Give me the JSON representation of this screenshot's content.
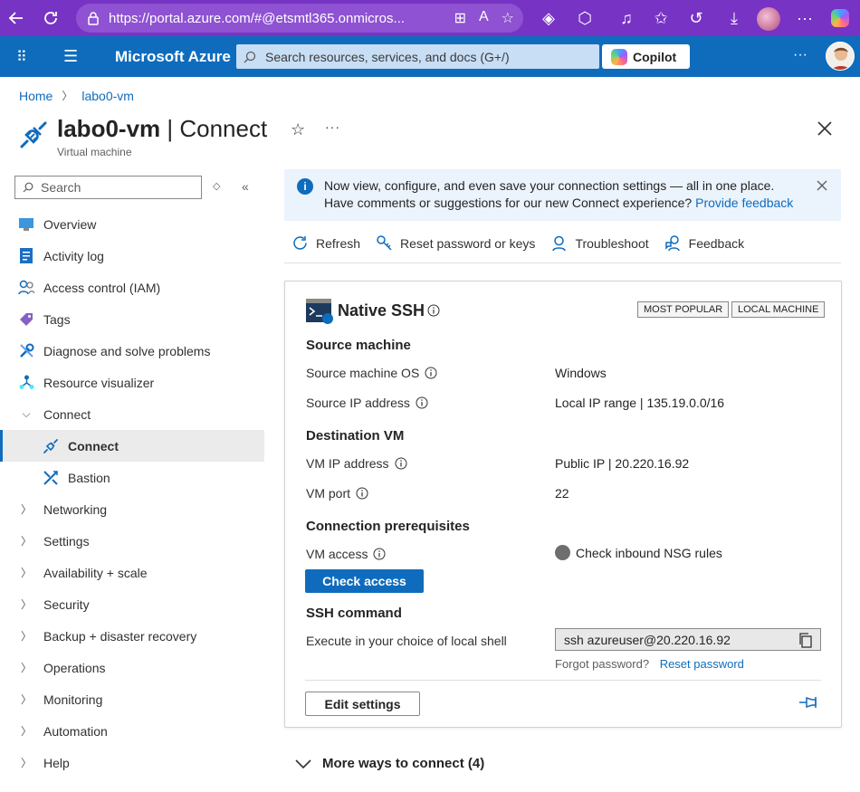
{
  "browser": {
    "url": "https://portal.azure.com/#@etsmtl365.onmicros..."
  },
  "header": {
    "brand": "Microsoft Azure",
    "search_placeholder": "Search resources, services, and docs (G+/)",
    "copilot_label": "Copilot",
    "more": "···"
  },
  "breadcrumb": {
    "home": "Home",
    "current": "labo0-vm"
  },
  "title": {
    "resource": "labo0-vm",
    "section": " | Connect",
    "subtitle": "Virtual machine",
    "more": "···"
  },
  "nav": {
    "search_placeholder": "Search",
    "items": [
      {
        "label": "Overview",
        "icon": "monitor-icon"
      },
      {
        "label": "Activity log",
        "icon": "activity-log-icon"
      },
      {
        "label": "Access control (IAM)",
        "icon": "people-icon"
      },
      {
        "label": "Tags",
        "icon": "tag-icon"
      },
      {
        "label": "Diagnose and solve problems",
        "icon": "wrench-icon"
      },
      {
        "label": "Resource visualizer",
        "icon": "network-icon"
      },
      {
        "label": "Connect",
        "expanded": true
      },
      {
        "label": "Connect",
        "icon": "plug-icon",
        "selected": true
      },
      {
        "label": "Bastion",
        "icon": "bastion-icon"
      },
      {
        "label": "Networking"
      },
      {
        "label": "Settings"
      },
      {
        "label": "Availability + scale"
      },
      {
        "label": "Security"
      },
      {
        "label": "Backup + disaster recovery"
      },
      {
        "label": "Operations"
      },
      {
        "label": "Monitoring"
      },
      {
        "label": "Automation"
      },
      {
        "label": "Help"
      }
    ]
  },
  "banner": {
    "line1": "Now view, configure, and even save your connection settings — all in one place.",
    "line2": "Have comments or suggestions for our new Connect experience?",
    "link": "Provide feedback"
  },
  "toolbar": {
    "refresh": "Refresh",
    "reset": "Reset password or keys",
    "troubleshoot": "Troubleshoot",
    "feedback": "Feedback"
  },
  "card": {
    "title": "Native SSH",
    "badge1": "MOST POPULAR",
    "badge2": "LOCAL MACHINE",
    "source_heading": "Source machine",
    "source_os_label": "Source machine OS",
    "source_os_value": "Windows",
    "source_ip_label": "Source IP address",
    "source_ip_value": "Local IP range | 135.19.0.0/16",
    "dest_heading": "Destination VM",
    "vm_ip_label": "VM IP address",
    "vm_ip_value": "Public IP | 20.220.16.92",
    "vm_port_label": "VM port",
    "vm_port_value": "22",
    "prereq_heading": "Connection prerequisites",
    "vm_access_label": "VM access",
    "check_access": "Check access",
    "nsg_status": "Check inbound NSG rules",
    "ssh_heading": "SSH command",
    "ssh_label": "Execute in your choice of local shell",
    "ssh_command": "ssh azureuser@20.220.16.92",
    "forgot": "Forgot password?",
    "reset_link": "Reset password",
    "edit_settings": "Edit settings"
  },
  "more_ways": "More ways to connect (4)",
  "colors": {
    "browser_purple": "#7733c4",
    "azure_blue": "#0f6cbd",
    "banner_bg": "#ebf3fc"
  }
}
